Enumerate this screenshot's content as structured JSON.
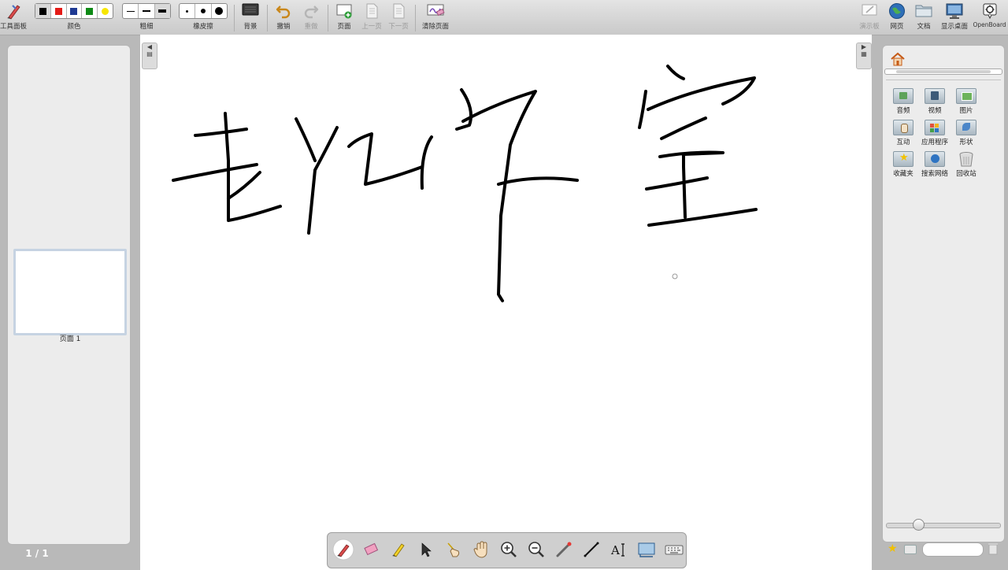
{
  "toolbar": {
    "tools_label": "工具面板",
    "color_label": "颜色",
    "colors": [
      "#000000",
      "#e41b17",
      "#1f3a93",
      "#0e8a16",
      "#f7e600"
    ],
    "width_label": "粗细",
    "eraser_label": "橡皮擦",
    "background_label": "背景",
    "undo_label": "撤销",
    "redo_label": "重做",
    "page_label": "页面",
    "prev_label": "上一页",
    "next_label": "下一页",
    "clear_label": "清除页面"
  },
  "right_toolbar": {
    "show_board_label": "演示板",
    "web_label": "网页",
    "documents_label": "文档",
    "desktop_label": "显示桌面",
    "openboard_label": "OpenBoard"
  },
  "left_panel": {
    "page_caption": "页面 1",
    "page_indicator": "1 / 1"
  },
  "library": {
    "items": [
      "音频",
      "视频",
      "图片",
      "互动",
      "应用程序",
      "形状",
      "收藏夹",
      "搜索网络",
      "回收站"
    ]
  }
}
